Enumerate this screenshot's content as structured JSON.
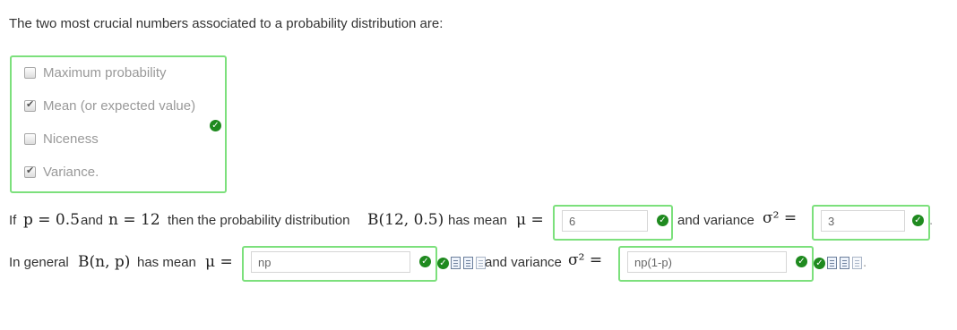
{
  "question": {
    "prompt": "The two most crucial numbers associated to a probability distribution are:",
    "choices": [
      {
        "label": "Maximum probability",
        "checked": false
      },
      {
        "label": "Mean (or expected value)",
        "checked": true
      },
      {
        "label": "Niceness",
        "checked": false
      },
      {
        "label": "Variance.",
        "checked": true
      }
    ],
    "status_icon": "check-circle-icon"
  },
  "specific": {
    "if": "If",
    "p_expr": "p = 0.5",
    "and": "and",
    "n_expr": "n = 12",
    "then": "then the probability distribution",
    "dist_expr": "B(12, 0.5)",
    "has_mean": "has mean",
    "mu_eq": "μ =",
    "mean_value": "6",
    "and_variance": "and variance",
    "sigma_eq": "σ² =",
    "variance_value": "3",
    "end": "."
  },
  "general": {
    "in_general": "In general",
    "dist_expr": "B(n, p)",
    "has_mean": "has mean",
    "mu_eq": "μ =",
    "mean_value": "np",
    "and_variance": "and variance",
    "sigma_eq": "σ² =",
    "variance_value": "np(1-p)",
    "end": "."
  },
  "colors": {
    "correct_border": "#7ce07c",
    "check": "#1f8a1f"
  }
}
